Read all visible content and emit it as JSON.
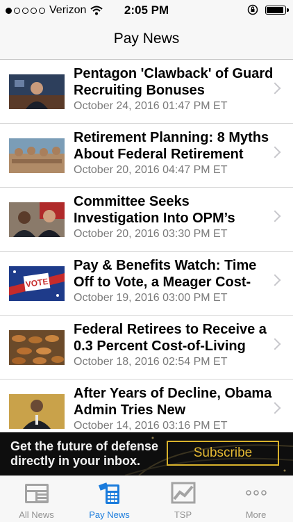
{
  "status_bar": {
    "carrier": "Verizon",
    "time": "2:05 PM"
  },
  "nav": {
    "title": "Pay News"
  },
  "articles": [
    {
      "title": "Pentagon 'Clawback' of Guard Recruiting Bonuses",
      "date": "October 24, 2016 01:47 PM ET"
    },
    {
      "title": "Retirement Planning: 8 Myths About Federal Retirement",
      "date": "October 20, 2016 04:47 PM ET"
    },
    {
      "title": "Committee Seeks Investigation Into OPM’s",
      "date": "October 20, 2016 03:30 PM ET"
    },
    {
      "title": "Pay & Benefits Watch: Time Off to Vote, a Meager Cost-",
      "date": "October 19, 2016 03:00 PM ET"
    },
    {
      "title": "Federal Retirees to Receive a 0.3 Percent Cost-of-Living",
      "date": "October 18, 2016 02:54 PM ET"
    },
    {
      "title": "After Years of Decline, Obama Admin Tries New",
      "date": "October 14, 2016 03:16 PM ET"
    }
  ],
  "ad": {
    "text": "Get the future of defense directly in your inbox.",
    "button": "Subscribe"
  },
  "tabs": [
    {
      "label": "All News",
      "icon": "newspaper-icon"
    },
    {
      "label": "Pay News",
      "icon": "calculator-icon"
    },
    {
      "label": "TSP",
      "icon": "chart-icon"
    },
    {
      "label": "More",
      "icon": "more-dots-icon"
    }
  ],
  "colors": {
    "accent": "#1a7bdc",
    "inactive": "#929292",
    "ad_gold": "#e3b833"
  }
}
